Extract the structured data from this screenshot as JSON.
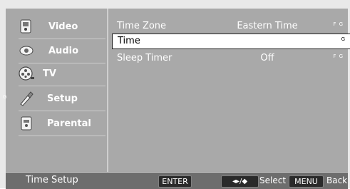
{
  "sidebar": {
    "items": [
      {
        "label": "Video",
        "icon": "video-icon",
        "marker": ""
      },
      {
        "label": "Audio",
        "icon": "audio-icon",
        "marker": ""
      },
      {
        "label": "TV",
        "icon": "tv-icon",
        "marker": ""
      },
      {
        "label": "Setup",
        "icon": "setup-icon",
        "marker": "G"
      },
      {
        "label": "Parental",
        "icon": "parental-icon",
        "marker": ""
      }
    ]
  },
  "main": {
    "rows": [
      {
        "label": "Time Zone",
        "value": "Eastern Time",
        "keys": "F G",
        "selected": false
      },
      {
        "label": "Time",
        "value": "",
        "keys": "G",
        "selected": true
      },
      {
        "label": "Sleep Timer",
        "value": "Off",
        "keys": "F G",
        "selected": false
      }
    ]
  },
  "footer": {
    "title": "Time Setup",
    "enter_label": "ENTER",
    "nav_label": "◂▸/◆",
    "select_label": "Select",
    "menu_label": "MENU",
    "back_label": "Back"
  },
  "colors": {
    "panel": "#a8a8a8",
    "footer": "#6d6d6d",
    "selected_row": "#ffffff"
  }
}
